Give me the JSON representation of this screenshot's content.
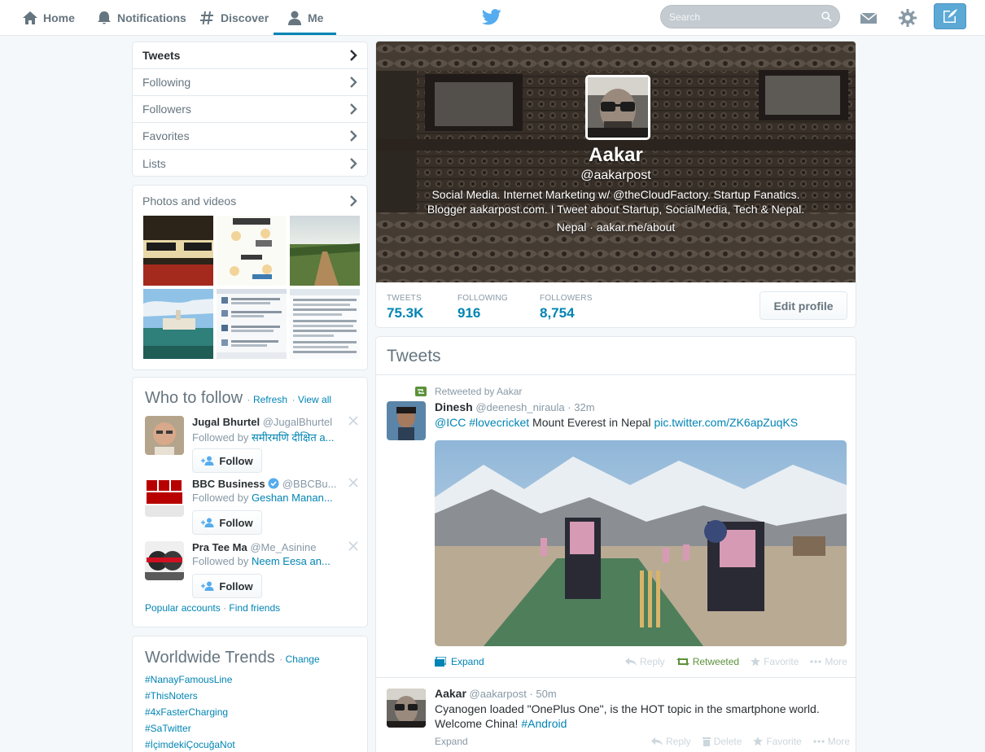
{
  "nav": {
    "home": "Home",
    "notifications": "Notifications",
    "discover": "Discover",
    "me": "Me",
    "search_placeholder": "Search"
  },
  "profile_nav": [
    "Tweets",
    "Following",
    "Followers",
    "Favorites",
    "Lists"
  ],
  "photos": {
    "title": "Photos and videos"
  },
  "who_to_follow": {
    "title": "Who to follow",
    "refresh": "Refresh",
    "view_all": "View all",
    "follow_label": "Follow",
    "suggestions": [
      {
        "name": "Jugal Bhurtel",
        "handle": "@JugalBhurtel",
        "followed_by_prefix": "Followed by ",
        "followed_by": "समीरमणि दीक्षित a..."
      },
      {
        "name": "BBC Business",
        "handle": "@BBCBu...",
        "followed_by_prefix": "Followed by ",
        "followed_by": "Geshan Manan..."
      },
      {
        "name": "Pra Tee Ma",
        "handle": "@Me_Asinine",
        "followed_by_prefix": "Followed by ",
        "followed_by": "Neem Eesa an..."
      }
    ],
    "popular": "Popular accounts",
    "find_friends": "Find friends"
  },
  "trends": {
    "title": "Worldwide Trends",
    "change": "Change",
    "items": [
      "#NanayFamousLine",
      "#ThisNoters",
      "#4xFasterCharging",
      "#SaTwitter",
      "#İçimdekiÇocuğaNot"
    ]
  },
  "profile": {
    "name": "Aakar",
    "handle": "@aakarpost",
    "bio_line1": "Social Media. Internet Marketing w/ @theCloudFactory. Startup Fanatics.",
    "bio_line2": "Blogger aakarpost.com. I Tweet about Startup, SocialMedia, Tech & Nepal.",
    "location": "Nepal",
    "url": "aakar.me/about",
    "stats": [
      {
        "label": "TWEETS",
        "value": "75.3K"
      },
      {
        "label": "FOLLOWING",
        "value": "916"
      },
      {
        "label": "FOLLOWERS",
        "value": "8,754"
      }
    ],
    "edit": "Edit profile"
  },
  "timeline": {
    "title": "Tweets",
    "tweets": [
      {
        "context": "Retweeted by Aakar",
        "name": "Dinesh",
        "handle": "@deenesh_niraula",
        "time": "32m",
        "mention": "@ICC",
        "hashtag": "#lovecricket",
        "text": " Mount Everest in Nepal ",
        "link": "pic.twitter.com/ZK6apZuqKS",
        "expand": "Expand",
        "reply": "Reply",
        "retweeted": "Retweeted",
        "favorite": "Favorite",
        "more": "More"
      },
      {
        "name": "Aakar",
        "handle": "@aakarpost",
        "time": "50m",
        "text_line1": "Cyanogen loaded \"OnePlus One\", is the HOT topic in the smartphone world.",
        "text_line2": "Welcome China! ",
        "hashtag": "#Android",
        "expand": "Expand",
        "reply": "Reply",
        "delete": "Delete",
        "favorite": "Favorite",
        "more": "More"
      }
    ]
  },
  "colors": {
    "link": "#0084b4",
    "bird": "#55acee",
    "retweet": "#5c913b"
  }
}
